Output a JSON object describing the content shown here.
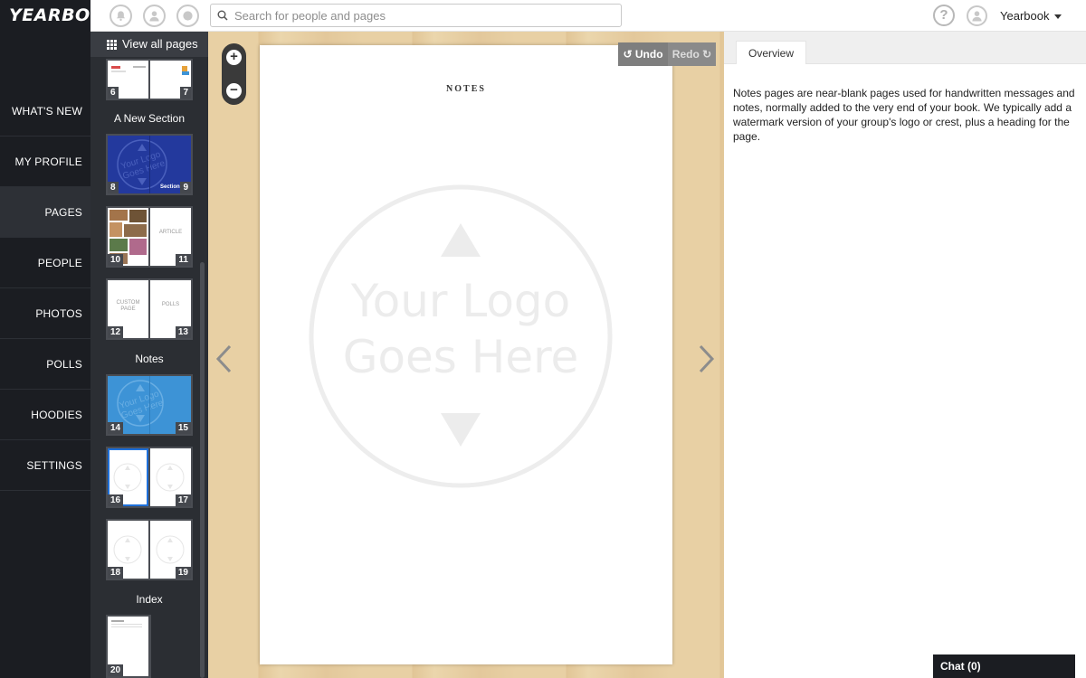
{
  "app": {
    "logo": "YEARBOOK"
  },
  "topbar": {
    "search_placeholder": "Search for people and pages",
    "help_symbol": "?",
    "user_name": "Yearbook"
  },
  "sidebar": {
    "items": [
      {
        "label": "WHAT'S NEW"
      },
      {
        "label": "MY PROFILE"
      },
      {
        "label": "PAGES",
        "active": true
      },
      {
        "label": "PEOPLE"
      },
      {
        "label": "PHOTOS"
      },
      {
        "label": "POLLS"
      },
      {
        "label": "HOODIES"
      },
      {
        "label": "SETTINGS"
      }
    ]
  },
  "pages_panel": {
    "view_all_label": "View all pages",
    "sections": [
      "A New Section",
      "Notes",
      "Index"
    ],
    "thumbs": [
      {
        "left": "6",
        "right": "7"
      },
      {
        "left": "8",
        "right": "9",
        "right_text": "Section N",
        "logo_text": "Your Logo Goes Here"
      },
      {
        "left": "10",
        "right": "11",
        "right_text": "ARTICLE"
      },
      {
        "left": "12",
        "right": "13",
        "left_text": "CUSTOM PAGE",
        "right_text": "POLLS"
      },
      {
        "left": "14",
        "right": "15",
        "logo_text": "Your Logo Goes Here"
      },
      {
        "left": "16",
        "right": "17"
      },
      {
        "left": "18",
        "right": "19"
      },
      {
        "left": "20"
      }
    ]
  },
  "editor": {
    "zoom_in": "+",
    "zoom_out": "−",
    "undo_label": "Undo",
    "redo_label": "Redo",
    "page_title": "Notes",
    "watermark_line1": "Your Logo",
    "watermark_line2": "Goes Here"
  },
  "right_panel": {
    "tab_label": "Overview",
    "description": "Notes pages are near-blank pages used for handwritten messages and notes, normally added to the very end of your book. We typically add a watermark version of your group's logo or crest, plus a heading for the page."
  },
  "chat": {
    "label": "Chat (0)"
  },
  "colors": {
    "sidebar_bg": "#1b1d22",
    "panel_bg": "#2b2e33",
    "selected_thumb_border": "#1e6fd9",
    "blue_section_page": "#23399d",
    "notes_cover_blue": "#3d93d6",
    "wood": "#e8d0a4"
  }
}
